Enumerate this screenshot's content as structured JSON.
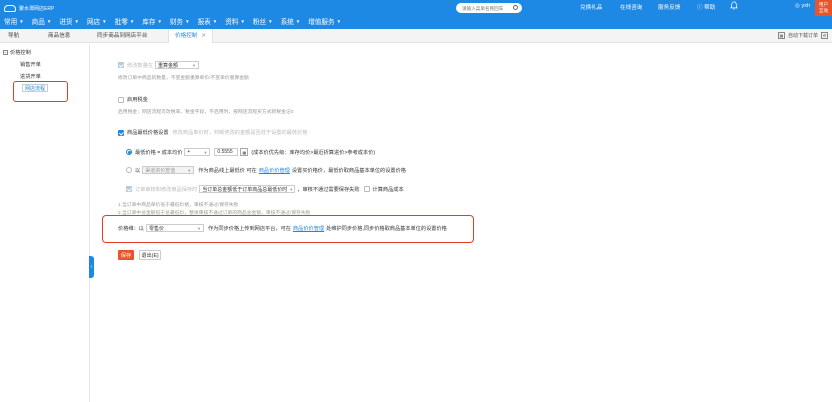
{
  "header": {
    "logo_text": "聚水潭网店ERP",
    "nav": [
      {
        "label": "常用"
      },
      {
        "label": "商品"
      },
      {
        "label": "进货"
      },
      {
        "label": "网店"
      },
      {
        "label": "批零"
      },
      {
        "label": "库存"
      },
      {
        "label": "财务"
      },
      {
        "label": "报表"
      },
      {
        "label": "资料"
      },
      {
        "label": "粉丝"
      },
      {
        "label": "系统"
      },
      {
        "label": "增值服务"
      }
    ],
    "search_placeholder": "请输入菜单名称回车",
    "links": [
      "兑换礼品",
      "在线咨询",
      "服务反馈",
      "帮助"
    ],
    "user": "yxh",
    "promo": "用户\n互动"
  },
  "tabs": {
    "items": [
      "导航",
      "商品信息",
      "同步商品到网店平台",
      "价格控制"
    ],
    "active_index": 3,
    "tools_label": "自动下载订单"
  },
  "sidebar": {
    "root": "价格控制",
    "items": [
      "销售开单",
      "进货开单",
      "网店流程"
    ],
    "selected_index": 2
  },
  "main": {
    "modify_qty": {
      "label": "修改数量在",
      "select": "重算金额",
      "hint": "修改订单中商品的数量，不变金额重算单价/不变单价重算金额"
    },
    "tax": {
      "label": "启用税金",
      "hint": "启用税金：网店流程可改税率、税金字段，不启用时，按网店流程买方式新税金记0"
    },
    "min_price": {
      "label": "商品最低价格设置",
      "hint": "修改商品单价时，判断修改的金额是否低于设置的最低价格"
    },
    "option1": {
      "prefix": "最低价格 = 成本均价",
      "op": "+",
      "value": "0.5555",
      "suffix": "(成本价优先级：库存均价>最近折算进价>参考成本价)"
    },
    "option2": {
      "prefix": "以",
      "select": "渠道进价签值",
      "mid": "作为商品线上最低价 可在",
      "link": "商品价价管理",
      "suffix": "设置买价格价，最低价取商品基本单位的设置价格"
    },
    "option3": {
      "prefix": "订单审核和修改商品保存时",
      "select": "当订单总金额低于订单商品总最低价时",
      "suffix": "，审核不通过需要保存失败",
      "extra": "计算商品成本"
    },
    "notes": [
      "1.当订单中商品单价低于最低价格，审核不通过/保存失败",
      "2.当订单中总金额低于总最低价，整体审核不通过订单的商品总金额，审核不通过/保存失败"
    ],
    "sync_price": {
      "prefix": "价格维：以",
      "select": "零售价",
      "mid": "作为同步价格上传到网店平台，可在",
      "link": "商品价价管理",
      "suffix": "处维护同步价格,同步价格取商品基本单位的设置价格"
    },
    "buttons": {
      "save": "保存",
      "cancel": "退出(E)"
    }
  }
}
